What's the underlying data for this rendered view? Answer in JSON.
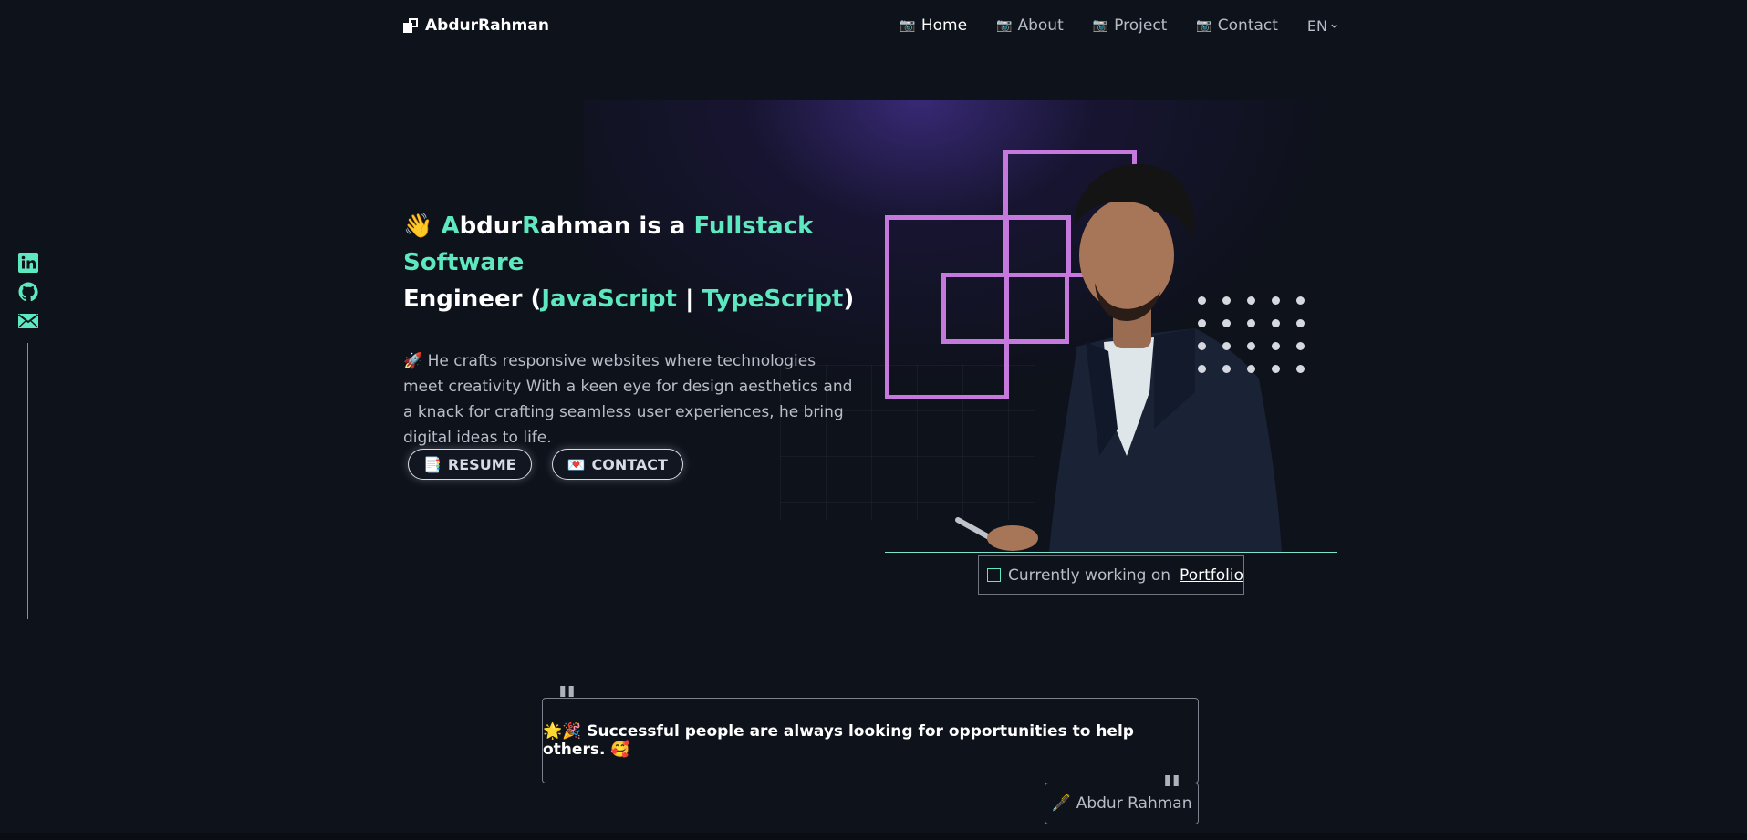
{
  "nav": {
    "brand": "AbdurRahman",
    "links": [
      {
        "icon": "📷",
        "label": "Home"
      },
      {
        "icon": "📷",
        "label": "About"
      },
      {
        "icon": "📷",
        "label": "Project"
      },
      {
        "icon": "📷",
        "label": "Contact"
      }
    ],
    "language": "EN"
  },
  "hero": {
    "wave": "👋",
    "name_a": "A",
    "name_b": "bdur",
    "name_c": "R",
    "name_d": "ahman",
    "is_a": " is a ",
    "role": "Fullstack Software",
    "engineer": "Engineer (",
    "tech1": "JavaScript",
    "sep": " | ",
    "tech2": "TypeScript",
    "close": ")",
    "description": "🚀 He crafts responsive websites where technologies meet creativity With a keen eye for design aesthetics and a knack for crafting seamless user experiences, he bring digital ideas to life.",
    "buttons": [
      {
        "icon": "📑",
        "label": "RESUME"
      },
      {
        "icon": "💌",
        "label": "CONTACT"
      }
    ]
  },
  "status": {
    "text": "Currently working on",
    "link": "Portfolio"
  },
  "quote": {
    "text": "🌟🎉 Successful people are always looking for opportunities to help others. 🥰",
    "open_mark": "\"",
    "close_mark": "\"",
    "author_icon": "🖋️",
    "author": "Abdur Rahman"
  },
  "colors": {
    "accent": "#5ee8c0",
    "frame": "#c679dc",
    "background": "#0e121b"
  },
  "social": [
    "linkedin-icon",
    "github-icon",
    "mail-icon"
  ]
}
